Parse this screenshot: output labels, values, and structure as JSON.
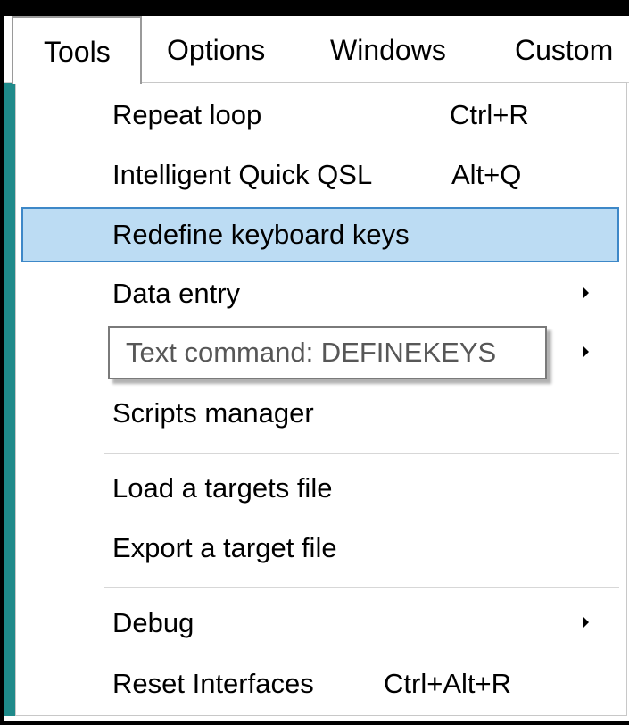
{
  "menubar": {
    "items": [
      {
        "label": "Tools"
      },
      {
        "label": "Options"
      },
      {
        "label": "Windows"
      },
      {
        "label": "Custom"
      }
    ]
  },
  "menu": {
    "items": [
      {
        "label": "Repeat loop",
        "shortcut": "Ctrl+R"
      },
      {
        "label": "Intelligent Quick QSL",
        "shortcut": "Alt+Q"
      },
      {
        "label": "Redefine keyboard keys",
        "shortcut": ""
      },
      {
        "label": "Data entry",
        "submenu": true
      },
      {
        "label": "",
        "submenu": true
      },
      {
        "label": "Scripts manager"
      },
      {
        "label": "Load a targets file"
      },
      {
        "label": "Export a target file"
      },
      {
        "label": "Debug",
        "submenu": true
      },
      {
        "label": "Reset Interfaces",
        "shortcut": "Ctrl+Alt+R"
      }
    ],
    "highlighted_index": 2
  },
  "tooltip": {
    "text": "Text command: DEFINEKEYS"
  },
  "colors": {
    "highlight_bg": "#bcdcf3",
    "highlight_border": "#3d88c8",
    "teal_accent": "#1f8a8a",
    "tooltip_text": "#575757"
  }
}
